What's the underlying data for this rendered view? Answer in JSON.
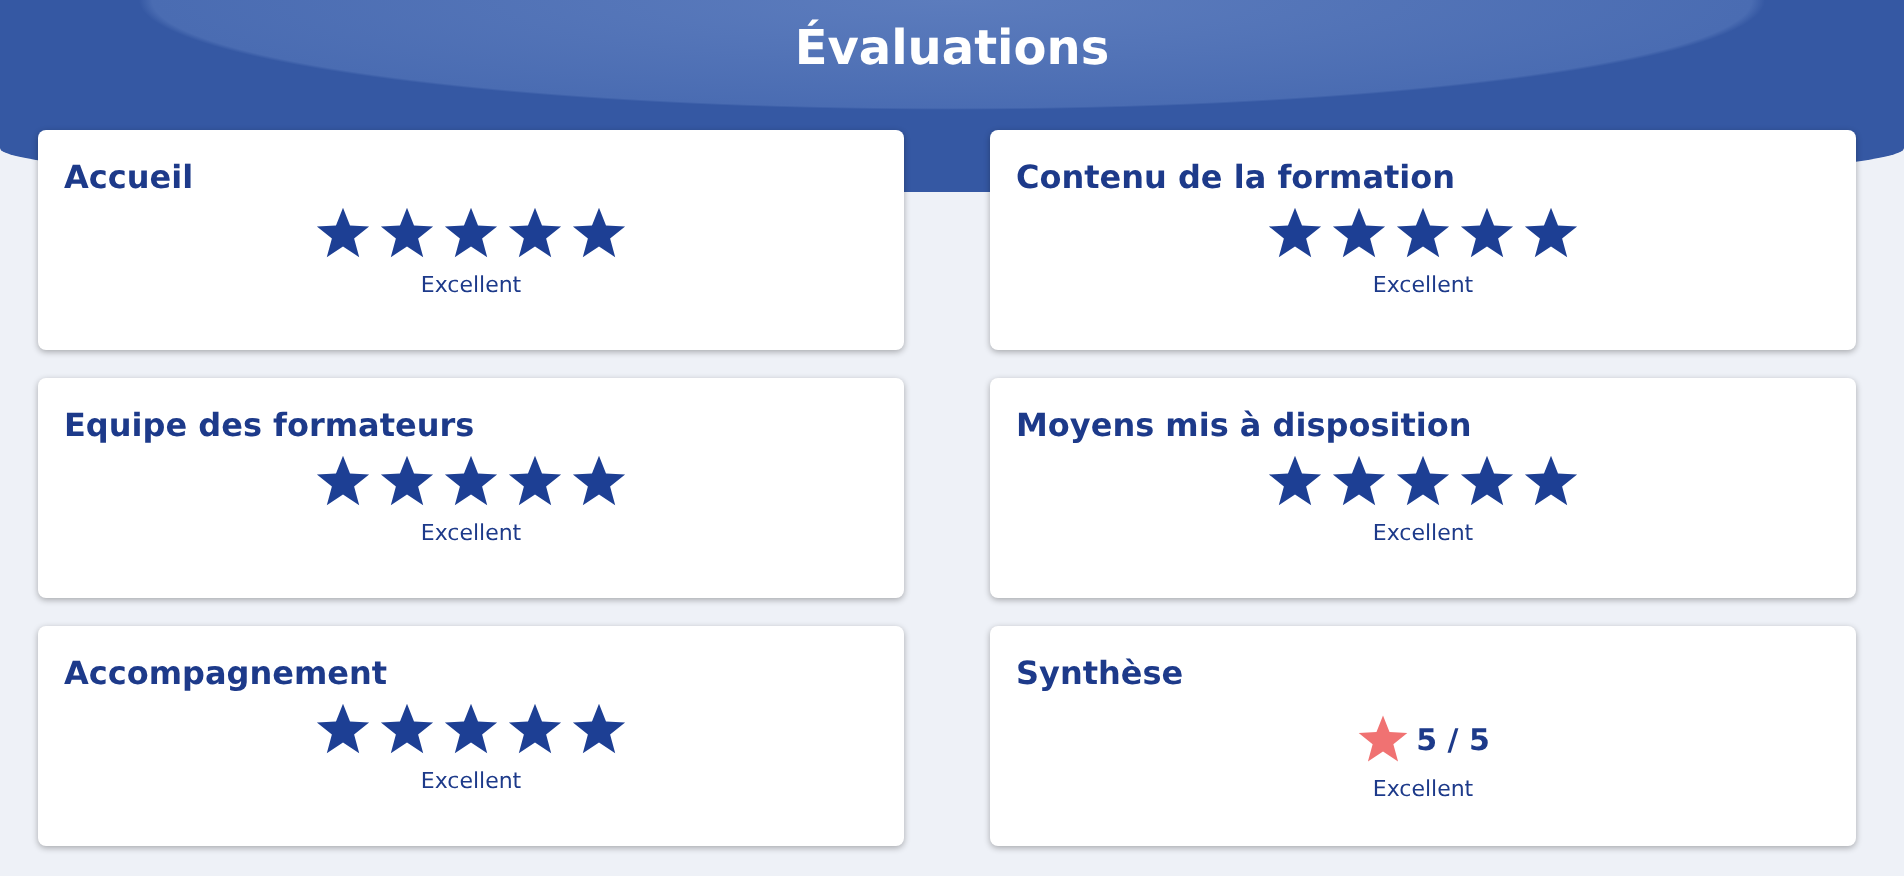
{
  "title": "Évaluations",
  "cards": [
    {
      "kind": "stars",
      "title": "Accueil",
      "stars": 5,
      "rating_label": "Excellent"
    },
    {
      "kind": "stars",
      "title": "Contenu de la formation",
      "stars": 5,
      "rating_label": "Excellent"
    },
    {
      "kind": "stars",
      "title": "Equipe des formateurs",
      "stars": 5,
      "rating_label": "Excellent"
    },
    {
      "kind": "stars",
      "title": "Moyens mis à disposition",
      "stars": 5,
      "rating_label": "Excellent"
    },
    {
      "kind": "stars",
      "title": "Accompagnement",
      "stars": 5,
      "rating_label": "Excellent"
    },
    {
      "kind": "score",
      "title": "Synthèse",
      "score": "5 / 5",
      "rating_label": "Excellent"
    }
  ]
}
